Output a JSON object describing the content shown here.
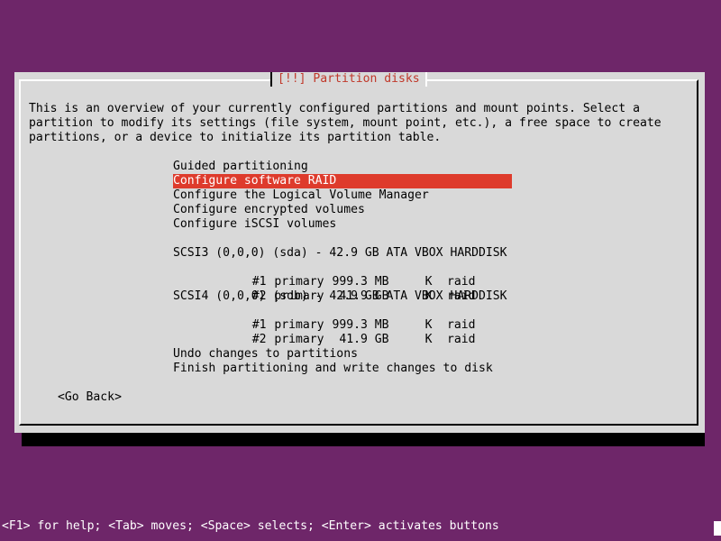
{
  "dialog": {
    "title": "[!!] Partition disks",
    "intro": [
      "This is an overview of your currently configured partitions and mount points. Select a",
      "partition to modify its settings (file system, mount point, etc.), a free space to create",
      "partitions, or a device to initialize its partition table."
    ],
    "menu": [
      {
        "label": "Guided partitioning",
        "selected": false
      },
      {
        "label": "Configure software RAID",
        "selected": true
      },
      {
        "label": "Configure the Logical Volume Manager",
        "selected": false
      },
      {
        "label": "Configure encrypted volumes",
        "selected": false
      },
      {
        "label": "Configure iSCSI volumes",
        "selected": false
      }
    ],
    "disks": [
      {
        "label": "SCSI3 (0,0,0) (sda) - 42.9 GB ATA VBOX HARDDISK",
        "partitions": [
          {
            "num": "#1",
            "type": "primary",
            "size": "999.3 MB",
            "flag": "K",
            "fs": "raid"
          },
          {
            "num": "#2",
            "type": "primary",
            "size": "41.9 GB",
            "flag": "K",
            "fs": "raid"
          }
        ]
      },
      {
        "label": "SCSI4 (0,0,0) (sdb) - 42.9 GB ATA VBOX HARDDISK",
        "partitions": [
          {
            "num": "#1",
            "type": "primary",
            "size": "999.3 MB",
            "flag": "K",
            "fs": "raid"
          },
          {
            "num": "#2",
            "type": "primary",
            "size": "41.9 GB",
            "flag": "K",
            "fs": "raid"
          }
        ]
      }
    ],
    "undo_label": "Undo changes to partitions",
    "finish_label": "Finish partitioning and write changes to disk",
    "go_back_label": "<Go Back>"
  },
  "help_bar": "<F1> for help; <Tab> moves; <Space> selects; <Enter> activates buttons",
  "colors": {
    "background": "#6e2669",
    "dialog": "#d9d9d9",
    "selection": "#de3b2c",
    "title": "#c0392b"
  }
}
